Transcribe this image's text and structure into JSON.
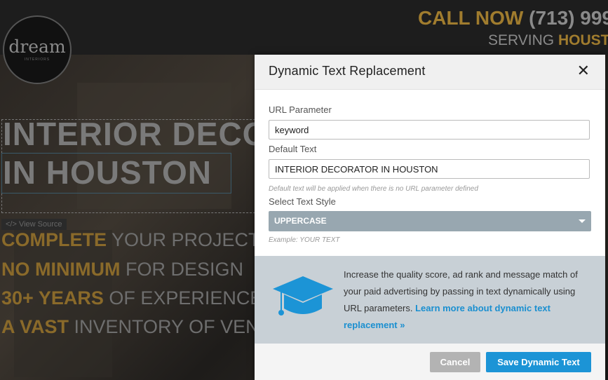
{
  "background": {
    "logo_text": "dream",
    "logo_sub": "INTERIORS",
    "call_label": "CALL NOW",
    "phone": "(713) 999",
    "serving_label": "SERVING",
    "serving_city": "HOUSTO",
    "headline_line1": "INTERIOR DECO",
    "headline_line2": "IN  HOUSTON",
    "view_source": "</> View Source",
    "features": [
      {
        "highlight": "COMPLETE",
        "rest": " YOUR PROJECT"
      },
      {
        "highlight": "NO MINIMUM",
        "rest": " FOR DESIGN"
      },
      {
        "highlight": "30+ YEARS",
        "rest": " OF EXPERIENCE"
      },
      {
        "highlight": "A VAST",
        "rest": " INVENTORY OF VEN"
      }
    ]
  },
  "modal": {
    "title": "Dynamic Text Replacement",
    "close_symbol": "✕",
    "url_param_label": "URL Parameter",
    "url_param_value": "keyword",
    "default_text_label": "Default Text",
    "default_text_value": "INTERIOR DECORATOR IN HOUSTON",
    "default_hint": "Default text will be applied when there is no URL parameter defined",
    "style_label": "Select Text Style",
    "style_selected": "UPPERCASE",
    "style_example": "Example: YOUR TEXT",
    "promo_text": "Increase the quality score, ad rank and message match of your paid advertising by passing in text dynamically using URL parameters. ",
    "promo_link": "Learn more about dynamic text replacement »",
    "cancel_label": "Cancel",
    "save_label": "Save Dynamic Text"
  },
  "colors": {
    "primary": "#1c94d6",
    "select_bg": "#98a7b0",
    "promo_bg": "#c8d0d6",
    "cap_icon": "#1c94d6"
  },
  "icons": {
    "close": "close-icon",
    "caret": "chevron-down-icon",
    "promo": "graduation-cap-icon"
  }
}
